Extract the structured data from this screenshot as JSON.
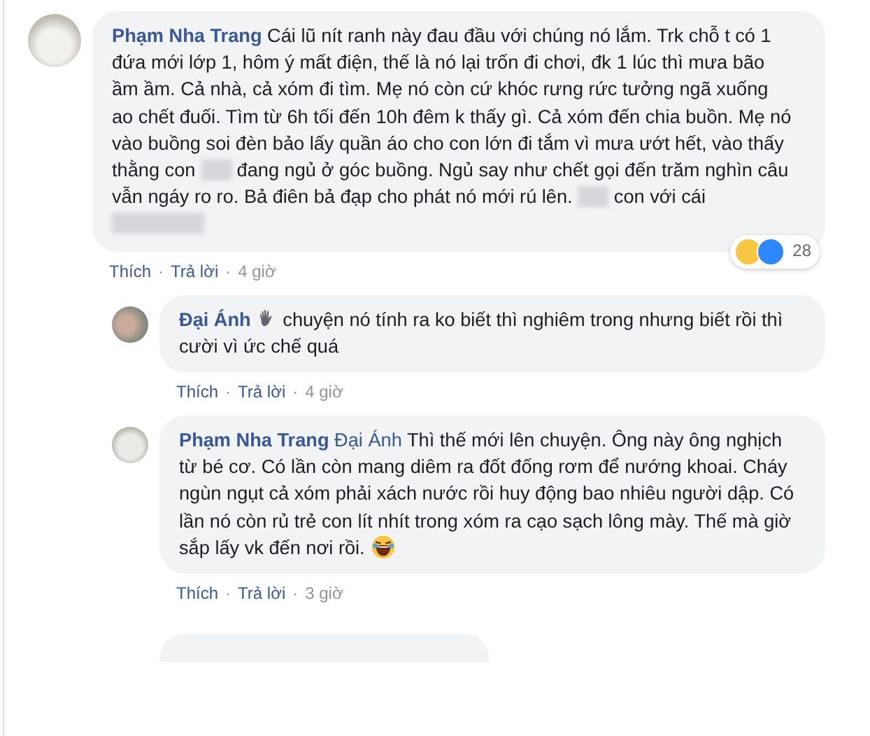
{
  "comments": [
    {
      "author": "Phạm Nha Trang",
      "badge": false,
      "segments": [
        {
          "kind": "text",
          "text": "Cái lũ nít ranh này đau đầu với chúng nó lắm. Trk chỗ t có 1 đứa mới lớp 1, hôm ý mất điện, thế là nó lại trốn đi chơi, đk 1 lúc thì mưa bão ầm ầm. Cả nhà, cả xóm đi tìm. Mẹ nó còn cứ khóc rưng rức tưởng ngã xuống ao chết đuối. Tìm từ 6h tối đến 10h đêm k thấy gì. Cả xóm đến chia buồn. Mẹ nó vào buồng soi đèn bảo lấy quần áo cho con lớn đi tắm vì mưa ướt hết, vào thấy thằng con"
        },
        {
          "kind": "redacted"
        },
        {
          "kind": "text",
          "text": "đang ngủ ở góc buồng. Ngủ say như chết gọi đến trăm nghìn câu vẫn ngáy ro ro. Bả điên bả đạp cho phát nó mới rú lên."
        },
        {
          "kind": "redacted"
        },
        {
          "kind": "text",
          "text": "con với cái"
        },
        {
          "kind": "redacted-long"
        }
      ],
      "actions": [
        "Thích",
        "Trả lời"
      ],
      "separator": "·",
      "time": "4 giờ",
      "reaction_count": "28",
      "replies": [
        {
          "author": "Đại Ánh",
          "badge": true,
          "segments": [
            {
              "kind": "text",
              "text": "chuyện nó tính ra ko biết thì nghiêm trong nhưng biết rồi thì cười vì ức chế quá"
            }
          ],
          "actions": [
            "Thích",
            "Trả lời"
          ],
          "separator": "·",
          "time": "4 giờ"
        },
        {
          "author": "Phạm Nha Trang",
          "badge": false,
          "segments": [
            {
              "kind": "mention",
              "text": "Đại Ánh"
            },
            {
              "kind": "text",
              "text": "Thì thế mới lên chuyện. Ông này ông nghịch từ bé cơ. Có lần còn mang diêm ra đốt đống rơm để nướng khoai. Cháy ngùn ngụt cả xóm phải xách nước rồi huy động bao nhiêu người dập. Có lần nó còn rủ trẻ con lít nhít trong xóm ra cạo sạch lông mày. Thế mà giờ sắp lấy vk đến nơi rồi."
            },
            {
              "kind": "emoji"
            }
          ],
          "actions": [
            "Thích",
            "Trả lời"
          ],
          "separator": "·",
          "time": "3 giờ"
        }
      ]
    }
  ]
}
